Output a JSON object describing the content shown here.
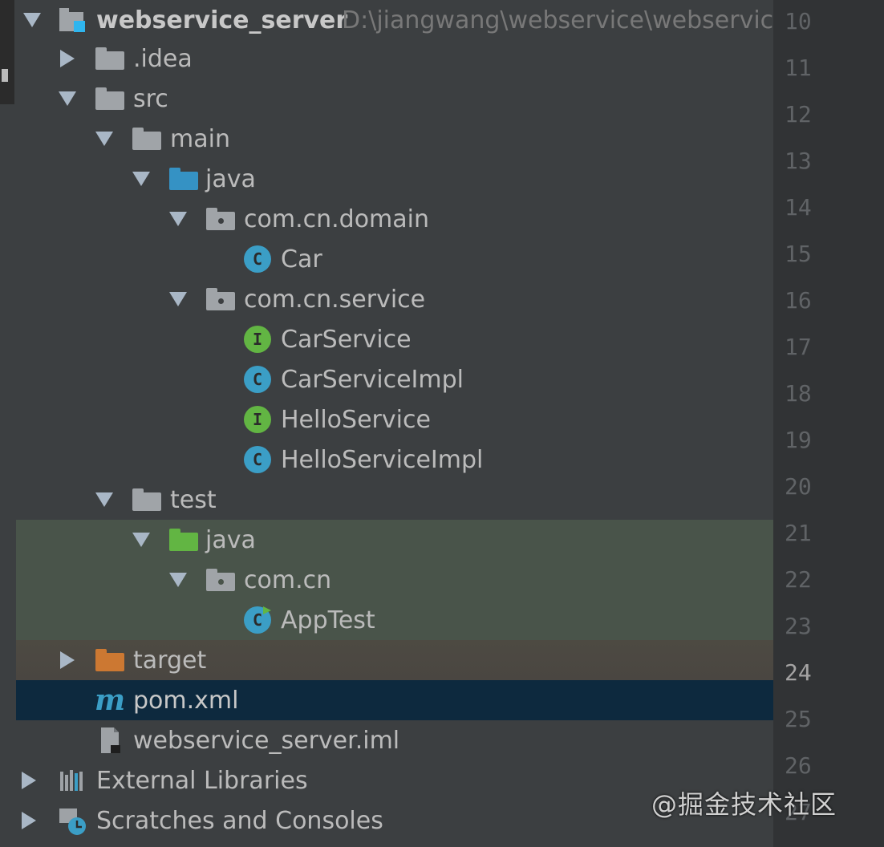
{
  "project": {
    "name": "webservice_server",
    "path": "D:\\jiangwang\\webservice\\webservic"
  },
  "tree": {
    "idea": ".idea",
    "src": "src",
    "main": "main",
    "main_java": "java",
    "domain_pkg": "com.cn.domain",
    "car": "Car",
    "service_pkg": "com.cn.service",
    "car_service": "CarService",
    "car_service_impl": "CarServiceImpl",
    "hello_service": "HelloService",
    "hello_service_impl": "HelloServiceImpl",
    "test": "test",
    "test_java": "java",
    "test_pkg": "com.cn",
    "app_test": "AppTest",
    "target": "target",
    "pom": "pom.xml",
    "iml": "webservice_server.iml",
    "external_libraries": "External Libraries",
    "scratches": "Scratches and Consoles"
  },
  "icon_glyphs": {
    "class": "C",
    "interface": "I",
    "maven": "m"
  },
  "gutter": {
    "lines": [
      "10",
      "11",
      "12",
      "13",
      "14",
      "15",
      "16",
      "17",
      "18",
      "19",
      "20",
      "21",
      "22",
      "23",
      "24",
      "25",
      "26",
      "27"
    ],
    "current_line": "24"
  },
  "colors": {
    "source_folder": "#3592c4",
    "test_folder": "#62b543",
    "excluded_folder": "#cc7832",
    "selection": "#0d293e"
  },
  "watermark": "@掘金技术社区"
}
